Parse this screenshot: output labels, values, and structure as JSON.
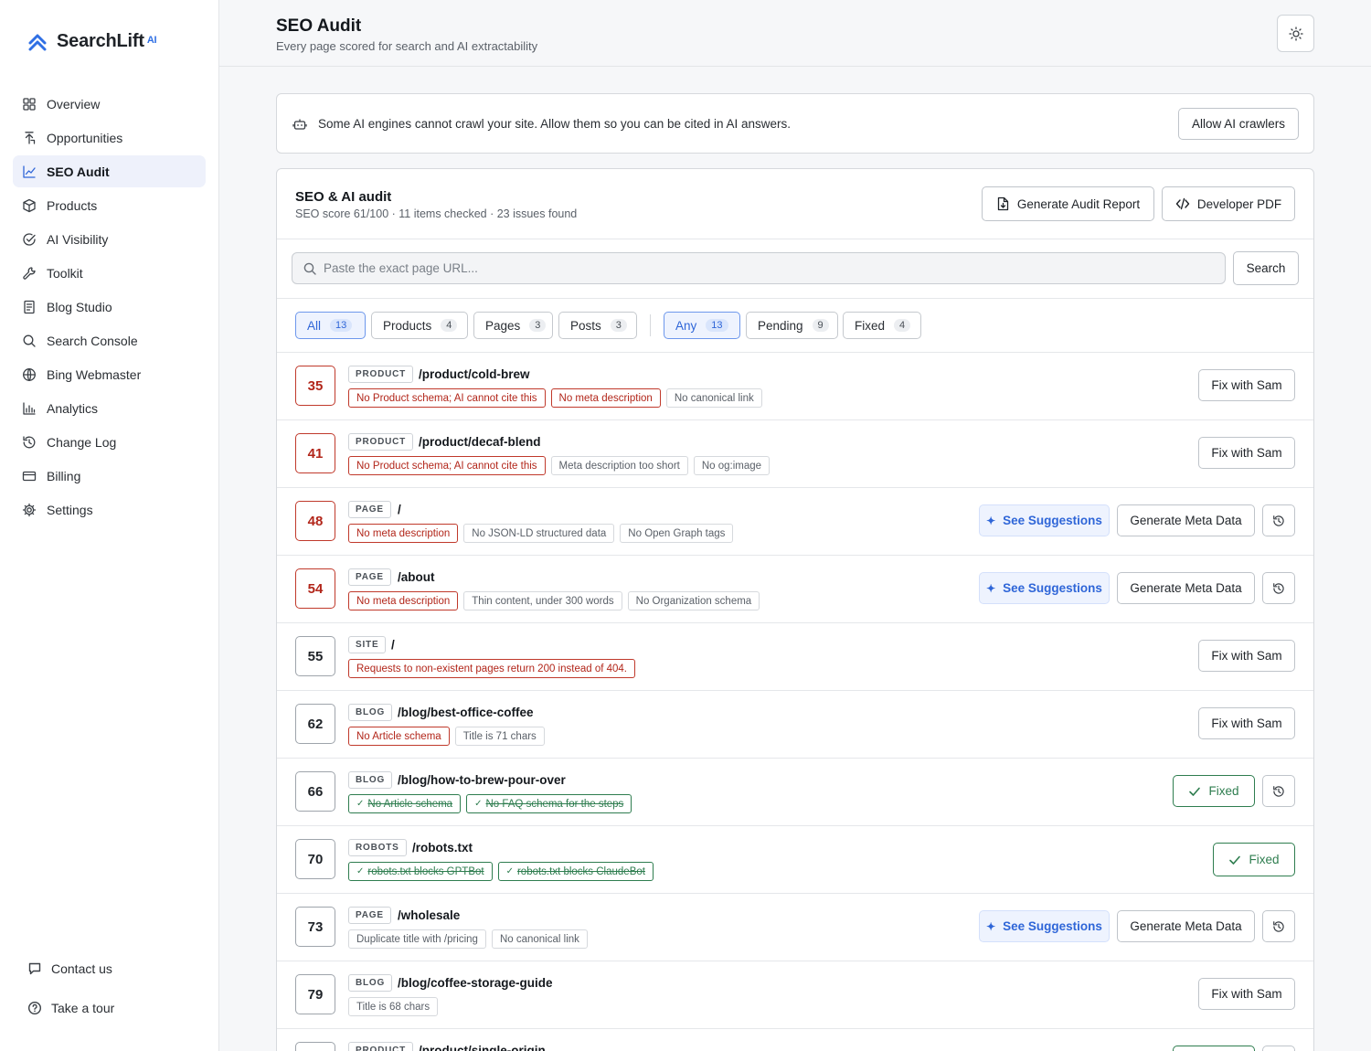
{
  "brand": {
    "name_a": "Search",
    "name_b": "Lift",
    "name_suffix": "AI"
  },
  "colors": {
    "accent": "#2f66d8",
    "error": "#b2261a",
    "success": "#2e7d4f"
  },
  "nav": [
    {
      "label": "Overview",
      "icon": "grid-icon"
    },
    {
      "label": "Opportunities",
      "icon": "opportunity-icon"
    },
    {
      "label": "SEO Audit",
      "icon": "chart-line-icon",
      "active": true
    },
    {
      "label": "Products",
      "icon": "box-icon"
    },
    {
      "label": "AI Visibility",
      "icon": "target-check-icon"
    },
    {
      "label": "Toolkit",
      "icon": "wrench-icon"
    },
    {
      "label": "Blog Studio",
      "icon": "document-icon"
    },
    {
      "label": "Search Console",
      "icon": "search-icon"
    },
    {
      "label": "Bing Webmaster",
      "icon": "globe-icon"
    },
    {
      "label": "Analytics",
      "icon": "bar-chart-icon"
    },
    {
      "label": "Change Log",
      "icon": "history-icon"
    },
    {
      "label": "Billing",
      "icon": "card-icon"
    },
    {
      "label": "Settings",
      "icon": "gear-icon"
    }
  ],
  "sidebar_bottom": {
    "contact": "Contact us",
    "tour": "Take a tour"
  },
  "header": {
    "title": "SEO Audit",
    "subtitle": "Every page scored for search and AI extractability"
  },
  "banner": {
    "text": "Some AI engines cannot crawl your site. Allow them so you can be cited in AI answers.",
    "button": "Allow AI crawlers"
  },
  "audit": {
    "title": "SEO & AI audit",
    "summary": "SEO score 61/100 · 11 items checked · 23 issues found",
    "report_button": "Generate Audit Report",
    "pdf_button": "Developer PDF",
    "search_placeholder": "Paste the exact page URL...",
    "search_button": "Search"
  },
  "filters_type": [
    {
      "label": "All",
      "count": "13",
      "active": true
    },
    {
      "label": "Products",
      "count": "4"
    },
    {
      "label": "Pages",
      "count": "3"
    },
    {
      "label": "Posts",
      "count": "3"
    }
  ],
  "filters_status": [
    {
      "label": "Any",
      "count": "13",
      "active": true
    },
    {
      "label": "Pending",
      "count": "9"
    },
    {
      "label": "Fixed",
      "count": "4"
    }
  ],
  "labels": {
    "fix_with_sam": "Fix with Sam",
    "see_suggestions": "See Suggestions",
    "generate_meta": "Generate Meta Data",
    "fixed": "Fixed"
  },
  "rows": [
    {
      "score": "35",
      "type": "PRODUCT",
      "path": "/product/cold-brew",
      "actions": "fix",
      "tags": [
        {
          "text": "No Product schema; AI cannot cite this",
          "kind": "err"
        },
        {
          "text": "No meta description",
          "kind": "err"
        },
        {
          "text": "No canonical link",
          "kind": "info"
        }
      ]
    },
    {
      "score": "41",
      "type": "PRODUCT",
      "path": "/product/decaf-blend",
      "actions": "fix",
      "tags": [
        {
          "text": "No Product schema; AI cannot cite this",
          "kind": "err"
        },
        {
          "text": "Meta description too short",
          "kind": "info"
        },
        {
          "text": "No og:image",
          "kind": "info"
        }
      ]
    },
    {
      "score": "48",
      "type": "PAGE",
      "path": "/",
      "actions": "suggest",
      "tags": [
        {
          "text": "No meta description",
          "kind": "err"
        },
        {
          "text": "No JSON-LD structured data",
          "kind": "info"
        },
        {
          "text": "No Open Graph tags",
          "kind": "info"
        }
      ]
    },
    {
      "score": "54",
      "type": "PAGE",
      "path": "/about",
      "actions": "suggest",
      "tags": [
        {
          "text": "No meta description",
          "kind": "err"
        },
        {
          "text": "Thin content, under 300 words",
          "kind": "info"
        },
        {
          "text": "No Organization schema",
          "kind": "info"
        }
      ]
    },
    {
      "score": "55",
      "type": "SITE",
      "path": "/",
      "actions": "fix",
      "tags": [
        {
          "text": "Requests to non-existent pages return 200 instead of 404.",
          "kind": "err"
        }
      ]
    },
    {
      "score": "62",
      "type": "BLOG",
      "path": "/blog/best-office-coffee",
      "actions": "fix",
      "tags": [
        {
          "text": "No Article schema",
          "kind": "err"
        },
        {
          "text": "Title is 71 chars",
          "kind": "info"
        }
      ]
    },
    {
      "score": "66",
      "type": "BLOG",
      "path": "/blog/how-to-brew-pour-over",
      "actions": "fixed-hist",
      "tags": [
        {
          "text": "No Article schema",
          "kind": "ok"
        },
        {
          "text": "No FAQ schema for the steps",
          "kind": "ok"
        }
      ]
    },
    {
      "score": "70",
      "type": "ROBOTS",
      "path": "/robots.txt",
      "actions": "fixed",
      "tags": [
        {
          "text": "robots.txt blocks GPTBot",
          "kind": "ok"
        },
        {
          "text": "robots.txt blocks ClaudeBot",
          "kind": "ok"
        }
      ]
    },
    {
      "score": "73",
      "type": "PAGE",
      "path": "/wholesale",
      "actions": "suggest",
      "tags": [
        {
          "text": "Duplicate title with /pricing",
          "kind": "info"
        },
        {
          "text": "No canonical link",
          "kind": "info"
        }
      ]
    },
    {
      "score": "79",
      "type": "BLOG",
      "path": "/blog/coffee-storage-guide",
      "actions": "fix",
      "tags": [
        {
          "text": "Title is 68 chars",
          "kind": "info"
        }
      ]
    },
    {
      "score": "",
      "type": "PRODUCT",
      "path": "/product/single-origin",
      "actions": "fixed-hist",
      "tags": []
    }
  ]
}
